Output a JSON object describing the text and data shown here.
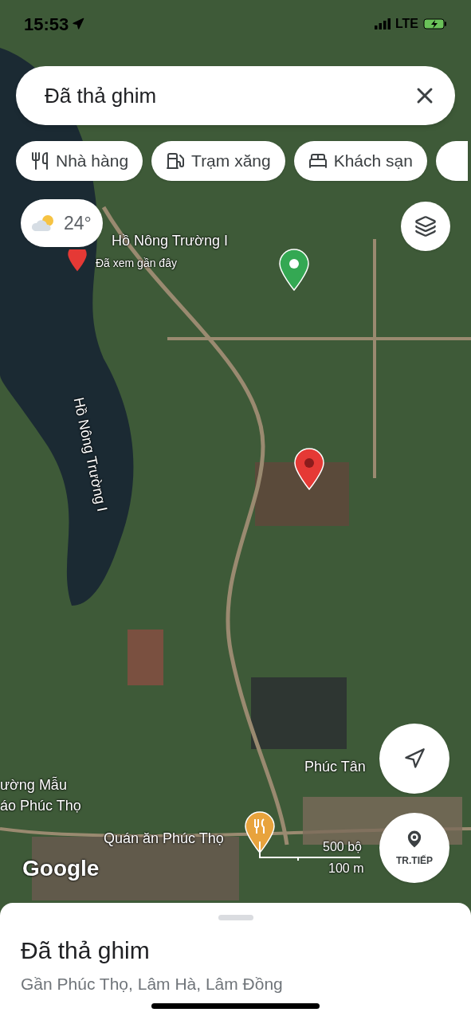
{
  "status_bar": {
    "time": "15:53",
    "network": "LTE"
  },
  "search": {
    "value": "Đã thả ghim"
  },
  "chips": [
    {
      "label": "Nhà hàng",
      "kind": "restaurant"
    },
    {
      "label": "Trạm xăng",
      "kind": "gas"
    },
    {
      "label": "Khách sạn",
      "kind": "hotel"
    }
  ],
  "weather": {
    "temperature": "24°"
  },
  "map": {
    "lake_label": "Hồ Nông Trường I",
    "lake_note": "Đã xem gần đây",
    "lake_name_on_water": "Hồ Nông Trường I",
    "village_label": "Phúc Tân",
    "school_label": [
      "ường Mẫu",
      "áo Phúc Thọ"
    ],
    "restaurant_label": "Quán ăn Phúc Thọ",
    "attribution": "Google",
    "scale": {
      "feet": "500 bộ",
      "meters": "100 m"
    }
  },
  "start_button": {
    "label": "TR.TIẾP"
  },
  "place_sheet": {
    "title": "Đã thả ghim",
    "address": "Gần Phúc Thọ, Lâm Hà, Lâm Đồng"
  }
}
